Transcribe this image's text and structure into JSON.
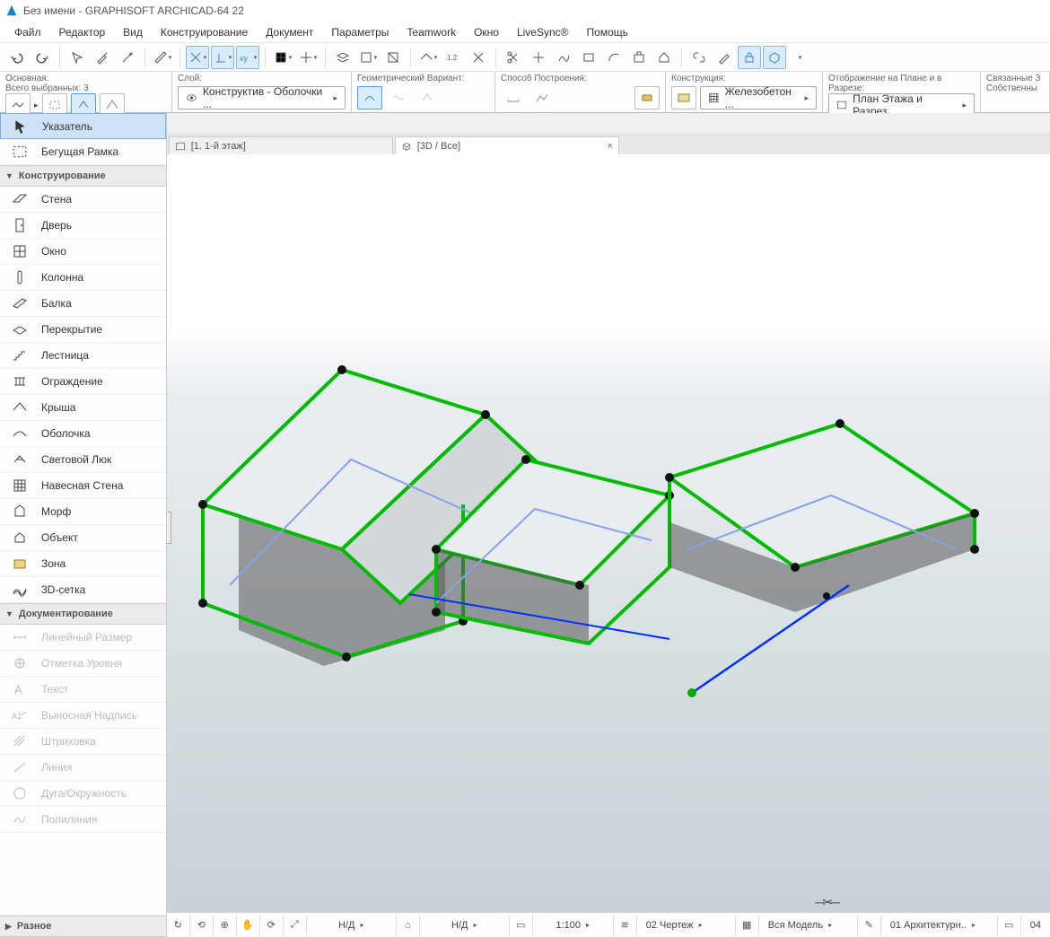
{
  "title": "Без имени - GRAPHISOFT ARCHICAD-64 22",
  "menu": [
    "Файл",
    "Редактор",
    "Вид",
    "Конструирование",
    "Документ",
    "Параметры",
    "Teamwork",
    "Окно",
    "LiveSync®",
    "Помощь"
  ],
  "prop": {
    "main": {
      "label": "Основная:",
      "selcount_label": "Всего выбранных:",
      "selcount": "3"
    },
    "layer": {
      "label": "Слой:",
      "value": "Конструктив - Оболочки ..."
    },
    "geom": {
      "label": "Геометрический Вариант:"
    },
    "constr": {
      "label": "Способ Построения:"
    },
    "design": {
      "label": "Конструкция:",
      "value": "Железобетон ..."
    },
    "plan": {
      "label": "Отображение на Плане и в Разрезе:",
      "value": "План Этажа и Разрез..."
    },
    "linked": {
      "label": "Связанные З",
      "sub": "Собственны"
    }
  },
  "tabs": [
    {
      "label": "[1. 1-й этаж]",
      "active": false
    },
    {
      "label": "[3D / Все]",
      "active": true
    }
  ],
  "toolgroups": {
    "select": [
      {
        "label": "Указатель",
        "icon": "pointer",
        "selected": true
      },
      {
        "label": "Бегущая Рамка",
        "icon": "marquee"
      }
    ],
    "design_title": "Конструирование",
    "design": [
      {
        "label": "Стена",
        "icon": "wall"
      },
      {
        "label": "Дверь",
        "icon": "door"
      },
      {
        "label": "Окно",
        "icon": "window"
      },
      {
        "label": "Колонна",
        "icon": "column"
      },
      {
        "label": "Балка",
        "icon": "beam"
      },
      {
        "label": "Перекрытие",
        "icon": "slab"
      },
      {
        "label": "Лестница",
        "icon": "stair"
      },
      {
        "label": "Ограждение",
        "icon": "railing"
      },
      {
        "label": "Крыша",
        "icon": "roof"
      },
      {
        "label": "Оболочка",
        "icon": "shell"
      },
      {
        "label": "Световой Люк",
        "icon": "skylight"
      },
      {
        "label": "Навесная Стена",
        "icon": "curtainwall"
      },
      {
        "label": "Морф",
        "icon": "morph"
      },
      {
        "label": "Объект",
        "icon": "object"
      },
      {
        "label": "Зона",
        "icon": "zone"
      },
      {
        "label": "3D-сетка",
        "icon": "mesh"
      }
    ],
    "doc_title": "Документирование",
    "doc": [
      {
        "label": "Линейный Размер",
        "icon": "dim",
        "disabled": true
      },
      {
        "label": "Отметка Уровня",
        "icon": "level",
        "disabled": true
      },
      {
        "label": "Текст",
        "icon": "text",
        "disabled": true
      },
      {
        "label": "Выносная Надпись",
        "icon": "label",
        "disabled": true
      },
      {
        "label": "Штриховка",
        "icon": "hatch",
        "disabled": true
      },
      {
        "label": "Линия",
        "icon": "line",
        "disabled": true
      },
      {
        "label": "Дуга/Окружность",
        "icon": "arc",
        "disabled": true
      },
      {
        "label": "Полилиния",
        "icon": "pline",
        "disabled": true
      }
    ],
    "misc_title": "Разное"
  },
  "status": {
    "nd1": "Н/Д",
    "nd2": "Н/Д",
    "scale": "1:100",
    "draw": "02 Чертеж",
    "model": "Вся Модель",
    "arch": "01 Архитектурн..",
    "last": "04"
  }
}
